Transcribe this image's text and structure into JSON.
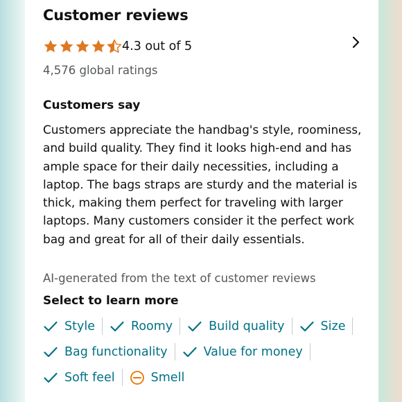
{
  "header": {
    "title": "Customer reviews"
  },
  "rating": {
    "stars_value": 4.3,
    "text": "4.3 out of 5",
    "global_ratings": "4,576 global ratings"
  },
  "customers_say": {
    "title": "Customers say",
    "summary": "Customers appreciate the handbag's style, roominess, and build quality. They find it looks high-end and has ample space for their daily necessities, including a laptop. The bags straps are sturdy and the material is thick, making them perfect for traveling with larger laptops. Many customers consider it the perfect work bag and great for all of their daily essentials.",
    "ai_note": "AI-generated from the text of customer reviews"
  },
  "learn_more": {
    "title": "Select to learn more",
    "aspects": [
      {
        "label": "Style",
        "icon": "check-icon"
      },
      {
        "label": "Roomy",
        "icon": "check-icon"
      },
      {
        "label": "Build quality",
        "icon": "check-icon"
      },
      {
        "label": "Size",
        "icon": "check-icon"
      },
      {
        "label": "Bag functionality",
        "icon": "check-icon"
      },
      {
        "label": "Value for money",
        "icon": "check-icon"
      },
      {
        "label": "Soft feel",
        "icon": "check-icon"
      },
      {
        "label": "Smell",
        "icon": "minus-circle-icon"
      }
    ]
  },
  "colors": {
    "star": "#de7921",
    "link": "#007185",
    "muted": "#565959",
    "text": "#0f1111",
    "neutral_icon": "#e77600"
  }
}
